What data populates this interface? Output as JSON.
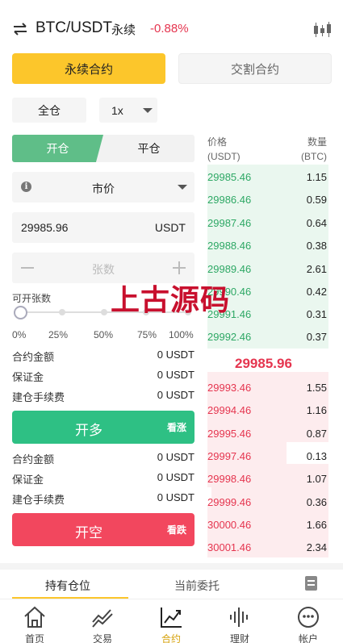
{
  "header": {
    "pair": "BTC/USDT",
    "contract_tag": "永续",
    "change": "-0.88%",
    "icons": {
      "swap": "swap-arrows-icon",
      "chart": "candlestick-icon"
    },
    "colors": {
      "down": "#e5354f",
      "up": "#2ea865"
    }
  },
  "contract_tabs": [
    "永续合约",
    "交割合约"
  ],
  "margin_mode": "全仓",
  "leverage": "1x",
  "side_tabs": [
    "开仓",
    "平仓"
  ],
  "order_type": "市价",
  "price": {
    "value": "29985.96",
    "unit": "USDT"
  },
  "quantity": {
    "placeholder": "张数"
  },
  "available_label": "可开张数",
  "slider": {
    "value_percent": 0,
    "marks": [
      "0%",
      "25%",
      "50%",
      "75%",
      "100%"
    ]
  },
  "long_summary": [
    {
      "label": "合约金额",
      "value": "0 USDT"
    },
    {
      "label": "保证金",
      "value": "0 USDT"
    },
    {
      "label": "建仓手续费",
      "value": "0 USDT"
    }
  ],
  "long_button": {
    "label": "开多",
    "tag": "看涨"
  },
  "short_summary": [
    {
      "label": "合约金额",
      "value": "0 USDT"
    },
    {
      "label": "保证金",
      "value": "0 USDT"
    },
    {
      "label": "建仓手续费",
      "value": "0 USDT"
    }
  ],
  "short_button": {
    "label": "开空",
    "tag": "看跌"
  },
  "orderbook": {
    "price_header": [
      "价格",
      "(USDT)"
    ],
    "qty_header": [
      "数量",
      "(BTC)"
    ],
    "bids": [
      {
        "price": "29985.46",
        "qty": "1.15"
      },
      {
        "price": "29986.46",
        "qty": "0.59"
      },
      {
        "price": "29987.46",
        "qty": "0.64"
      },
      {
        "price": "29988.46",
        "qty": "0.38"
      },
      {
        "price": "29989.46",
        "qty": "2.61"
      },
      {
        "price": "29990.46",
        "qty": "0.42"
      },
      {
        "price": "29991.46",
        "qty": "0.31"
      },
      {
        "price": "29992.46",
        "qty": "0.37"
      }
    ],
    "mid_price": "29985.96",
    "asks": [
      {
        "price": "29993.46",
        "qty": "1.55"
      },
      {
        "price": "29994.46",
        "qty": "1.16"
      },
      {
        "price": "29995.46",
        "qty": "0.87"
      },
      {
        "price": "29997.46",
        "qty": "0.13"
      },
      {
        "price": "29998.46",
        "qty": "1.07"
      },
      {
        "price": "29999.46",
        "qty": "0.36"
      },
      {
        "price": "30000.46",
        "qty": "1.66"
      },
      {
        "price": "30001.46",
        "qty": "2.34"
      }
    ]
  },
  "watermark": "上古源码",
  "bottom_tabs": [
    "持有仓位",
    "当前委托"
  ],
  "nav": [
    {
      "label": "首页",
      "icon": "home-icon"
    },
    {
      "label": "交易",
      "icon": "trend-icon"
    },
    {
      "label": "合约",
      "icon": "contract-chart-icon",
      "active": true
    },
    {
      "label": "理财",
      "icon": "waveform-icon"
    },
    {
      "label": "帐户",
      "icon": "account-face-icon"
    }
  ]
}
